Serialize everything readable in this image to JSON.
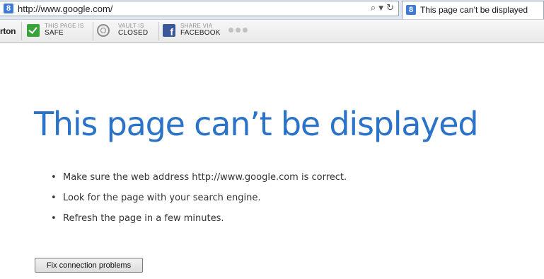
{
  "browser": {
    "address_url": "http://www.google.com/",
    "tab_title": "This page can’t be displayed",
    "favicon_letter": "8"
  },
  "toolbar": {
    "brand": "rton",
    "safety": {
      "label_small": "THIS PAGE IS",
      "label_big": "SAFE"
    },
    "vault": {
      "label_small": "VAULT IS",
      "label_big": "CLOSED"
    },
    "share": {
      "label_small": "SHARE VIA",
      "label_big": "FACEBOOK"
    }
  },
  "error_page": {
    "title": "This page can’t be displayed",
    "tips": [
      "Make sure the web address http://www.google.com is correct.",
      "Look for the page with your search engine.",
      "Refresh the page in a few minutes."
    ],
    "fix_button": "Fix connection problems"
  },
  "colors": {
    "title_blue": "#2b73c8",
    "safe_green": "#3aa23a",
    "facebook_blue": "#3b5998"
  },
  "icons": {
    "search": "search-icon",
    "dropdown": "chevron-down-icon",
    "refresh": "refresh-icon",
    "safe": "check-icon",
    "vault": "vault-icon",
    "facebook": "facebook-icon",
    "more": "more-dots-icon"
  }
}
